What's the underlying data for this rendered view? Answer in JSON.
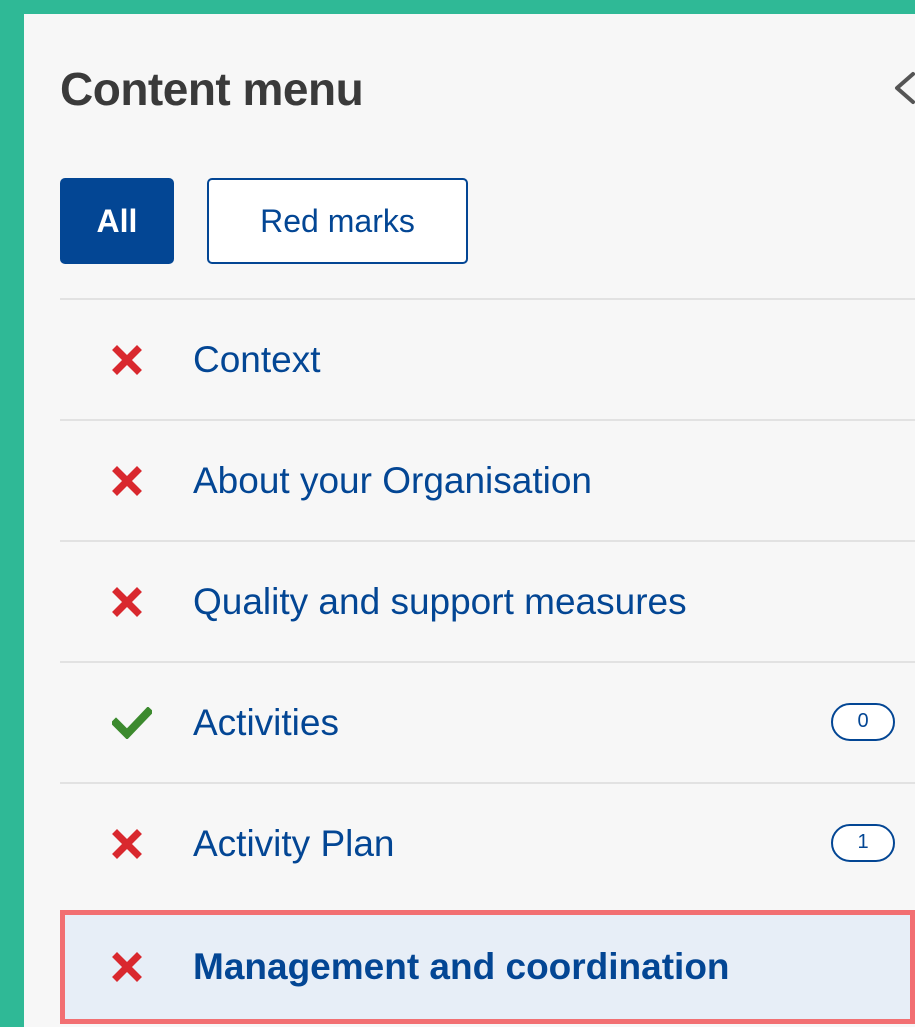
{
  "panel": {
    "title": "Content menu",
    "collapse_icon": "chevron-left-icon"
  },
  "filters": {
    "all_label": "All",
    "red_marks_label": "Red marks",
    "active": "All"
  },
  "menu": {
    "items": [
      {
        "label": "Context",
        "status": "incomplete",
        "status_icon": "cross-icon"
      },
      {
        "label": "About your Organisation",
        "status": "incomplete",
        "status_icon": "cross-icon"
      },
      {
        "label": "Quality and support measures",
        "status": "incomplete",
        "status_icon": "cross-icon"
      },
      {
        "label": "Activities",
        "status": "complete",
        "status_icon": "check-icon",
        "count": "0"
      },
      {
        "label": "Activity Plan",
        "status": "incomplete",
        "status_icon": "cross-icon",
        "count": "1"
      },
      {
        "label": "Management and coordination",
        "status": "incomplete",
        "status_icon": "cross-icon",
        "active": true
      }
    ]
  },
  "colors": {
    "background": "#2fb996",
    "primary": "#034694",
    "error": "#d9282e",
    "success": "#3c8a2e",
    "highlight_border": "#f26f72",
    "active_item_bg": "#e7eef7"
  }
}
